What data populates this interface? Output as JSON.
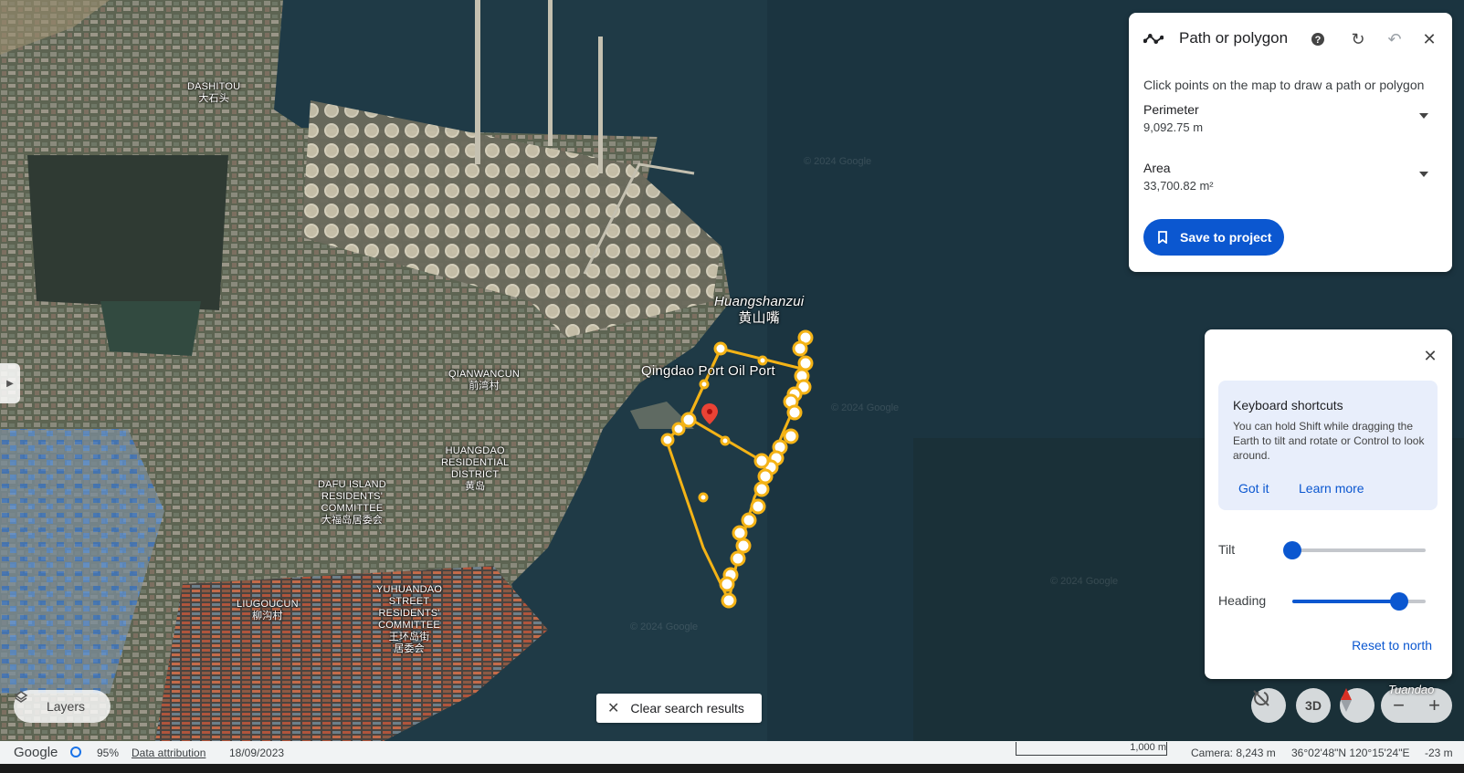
{
  "map": {
    "places": [
      {
        "id": "dashitou",
        "lines": [
          "DASHITOU",
          "大石头"
        ]
      },
      {
        "id": "qianwancun",
        "lines": [
          "QIANWANCUN",
          "前湾村"
        ]
      },
      {
        "id": "huangdao",
        "lines": [
          "HUANGDAO",
          "RESIDENTIAL",
          "DISTRICT",
          "黄岛"
        ]
      },
      {
        "id": "dafu",
        "lines": [
          "DAFU ISLAND",
          "RESIDENTS'",
          "COMMITTEE",
          "大福岛居委会"
        ]
      },
      {
        "id": "liugoucun",
        "lines": [
          "LIUGOUCUN",
          "柳沟村"
        ]
      },
      {
        "id": "yuhuandao",
        "lines": [
          "YUHUANDAO",
          "STREET",
          "RESIDENTS'",
          "COMMITTEE",
          "王环岛街",
          "居委会"
        ]
      }
    ],
    "huangshanzui": [
      "Huangshanzui",
      "黄山嘴"
    ],
    "poi_label": "Qingdao Port Oil Port",
    "corner_label": "Tuandao",
    "watermark": "© 2024 Google"
  },
  "measure": {
    "title": "Path or polygon",
    "hint": "Click points on the map to draw a path or polygon",
    "perimeter_label": "Perimeter",
    "perimeter_value": "9,092.75 m",
    "area_label": "Area",
    "area_value": "33,700.82 m²",
    "save_label": "Save to project"
  },
  "navigation": {
    "shortcuts_title": "Keyboard shortcuts",
    "shortcuts_text": "You can hold Shift while dragging the Earth to tilt and rotate or Control to look around.",
    "got_it": "Got it",
    "learn_more": "Learn more",
    "tilt_label": "Tilt",
    "tilt_value": 0.0,
    "heading_label": "Heading",
    "heading_value": 0.8,
    "reset_label": "Reset to north"
  },
  "controls": {
    "layers_label": "Layers",
    "clear_label": "Clear search results",
    "threed_label": "3D"
  },
  "status": {
    "brand": "Google",
    "load_percent": "95%",
    "attribution": "Data attribution",
    "date": "18/09/2023",
    "scale": "1,000 m",
    "camera": "Camera: 8,243 m",
    "coords": "36°02'48\"N 120°15'24\"E",
    "elevation": "-23 m"
  }
}
